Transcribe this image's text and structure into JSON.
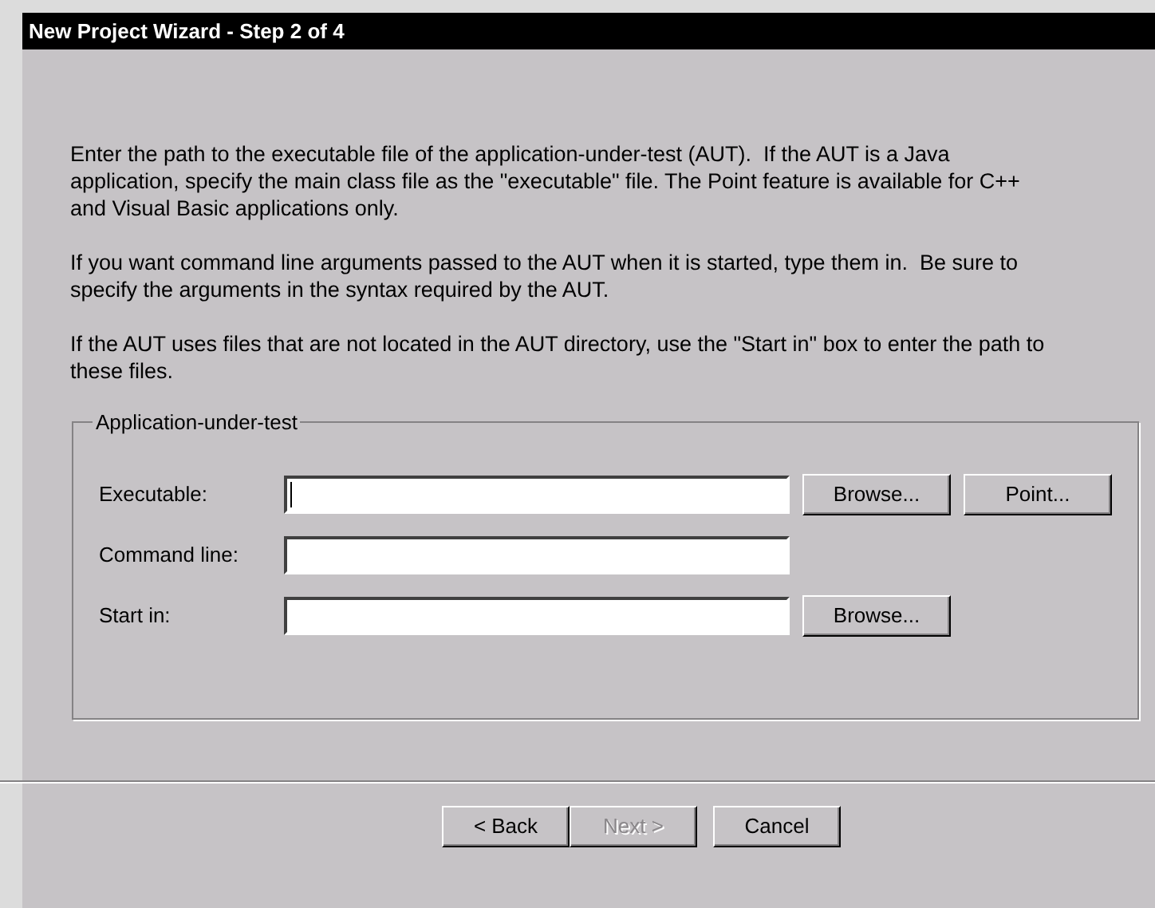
{
  "window": {
    "title": "New Project Wizard - Step 2 of 4"
  },
  "paragraphs": [
    "Enter the path to the executable file of the application-under-test (AUT).  If the AUT is a Java application, specify the main class file as the \"executable\" file. The Point feature is available for C++ and Visual Basic applications only.",
    "If you want command line arguments passed to the AUT when it is started, type them in.  Be sure to specify the arguments in the syntax required by the AUT.",
    "If the AUT uses files that are not located in the AUT directory, use the \"Start in\" box to enter the path to these files."
  ],
  "group": {
    "title": "Application-under-test",
    "rows": [
      {
        "label": "Executable:",
        "focused": true,
        "buttons": [
          {
            "label": "Browse..."
          },
          {
            "label": "Point..."
          }
        ]
      },
      {
        "label": "Command line:",
        "focused": false,
        "buttons": []
      },
      {
        "label": "Start in:",
        "focused": false,
        "buttons": [
          {
            "label": "Browse..."
          }
        ]
      }
    ]
  },
  "footer_buttons": [
    {
      "label": "< Back",
      "disabled": false
    },
    {
      "label": "Next >",
      "disabled": true
    },
    {
      "label": "Cancel",
      "disabled": false
    }
  ]
}
